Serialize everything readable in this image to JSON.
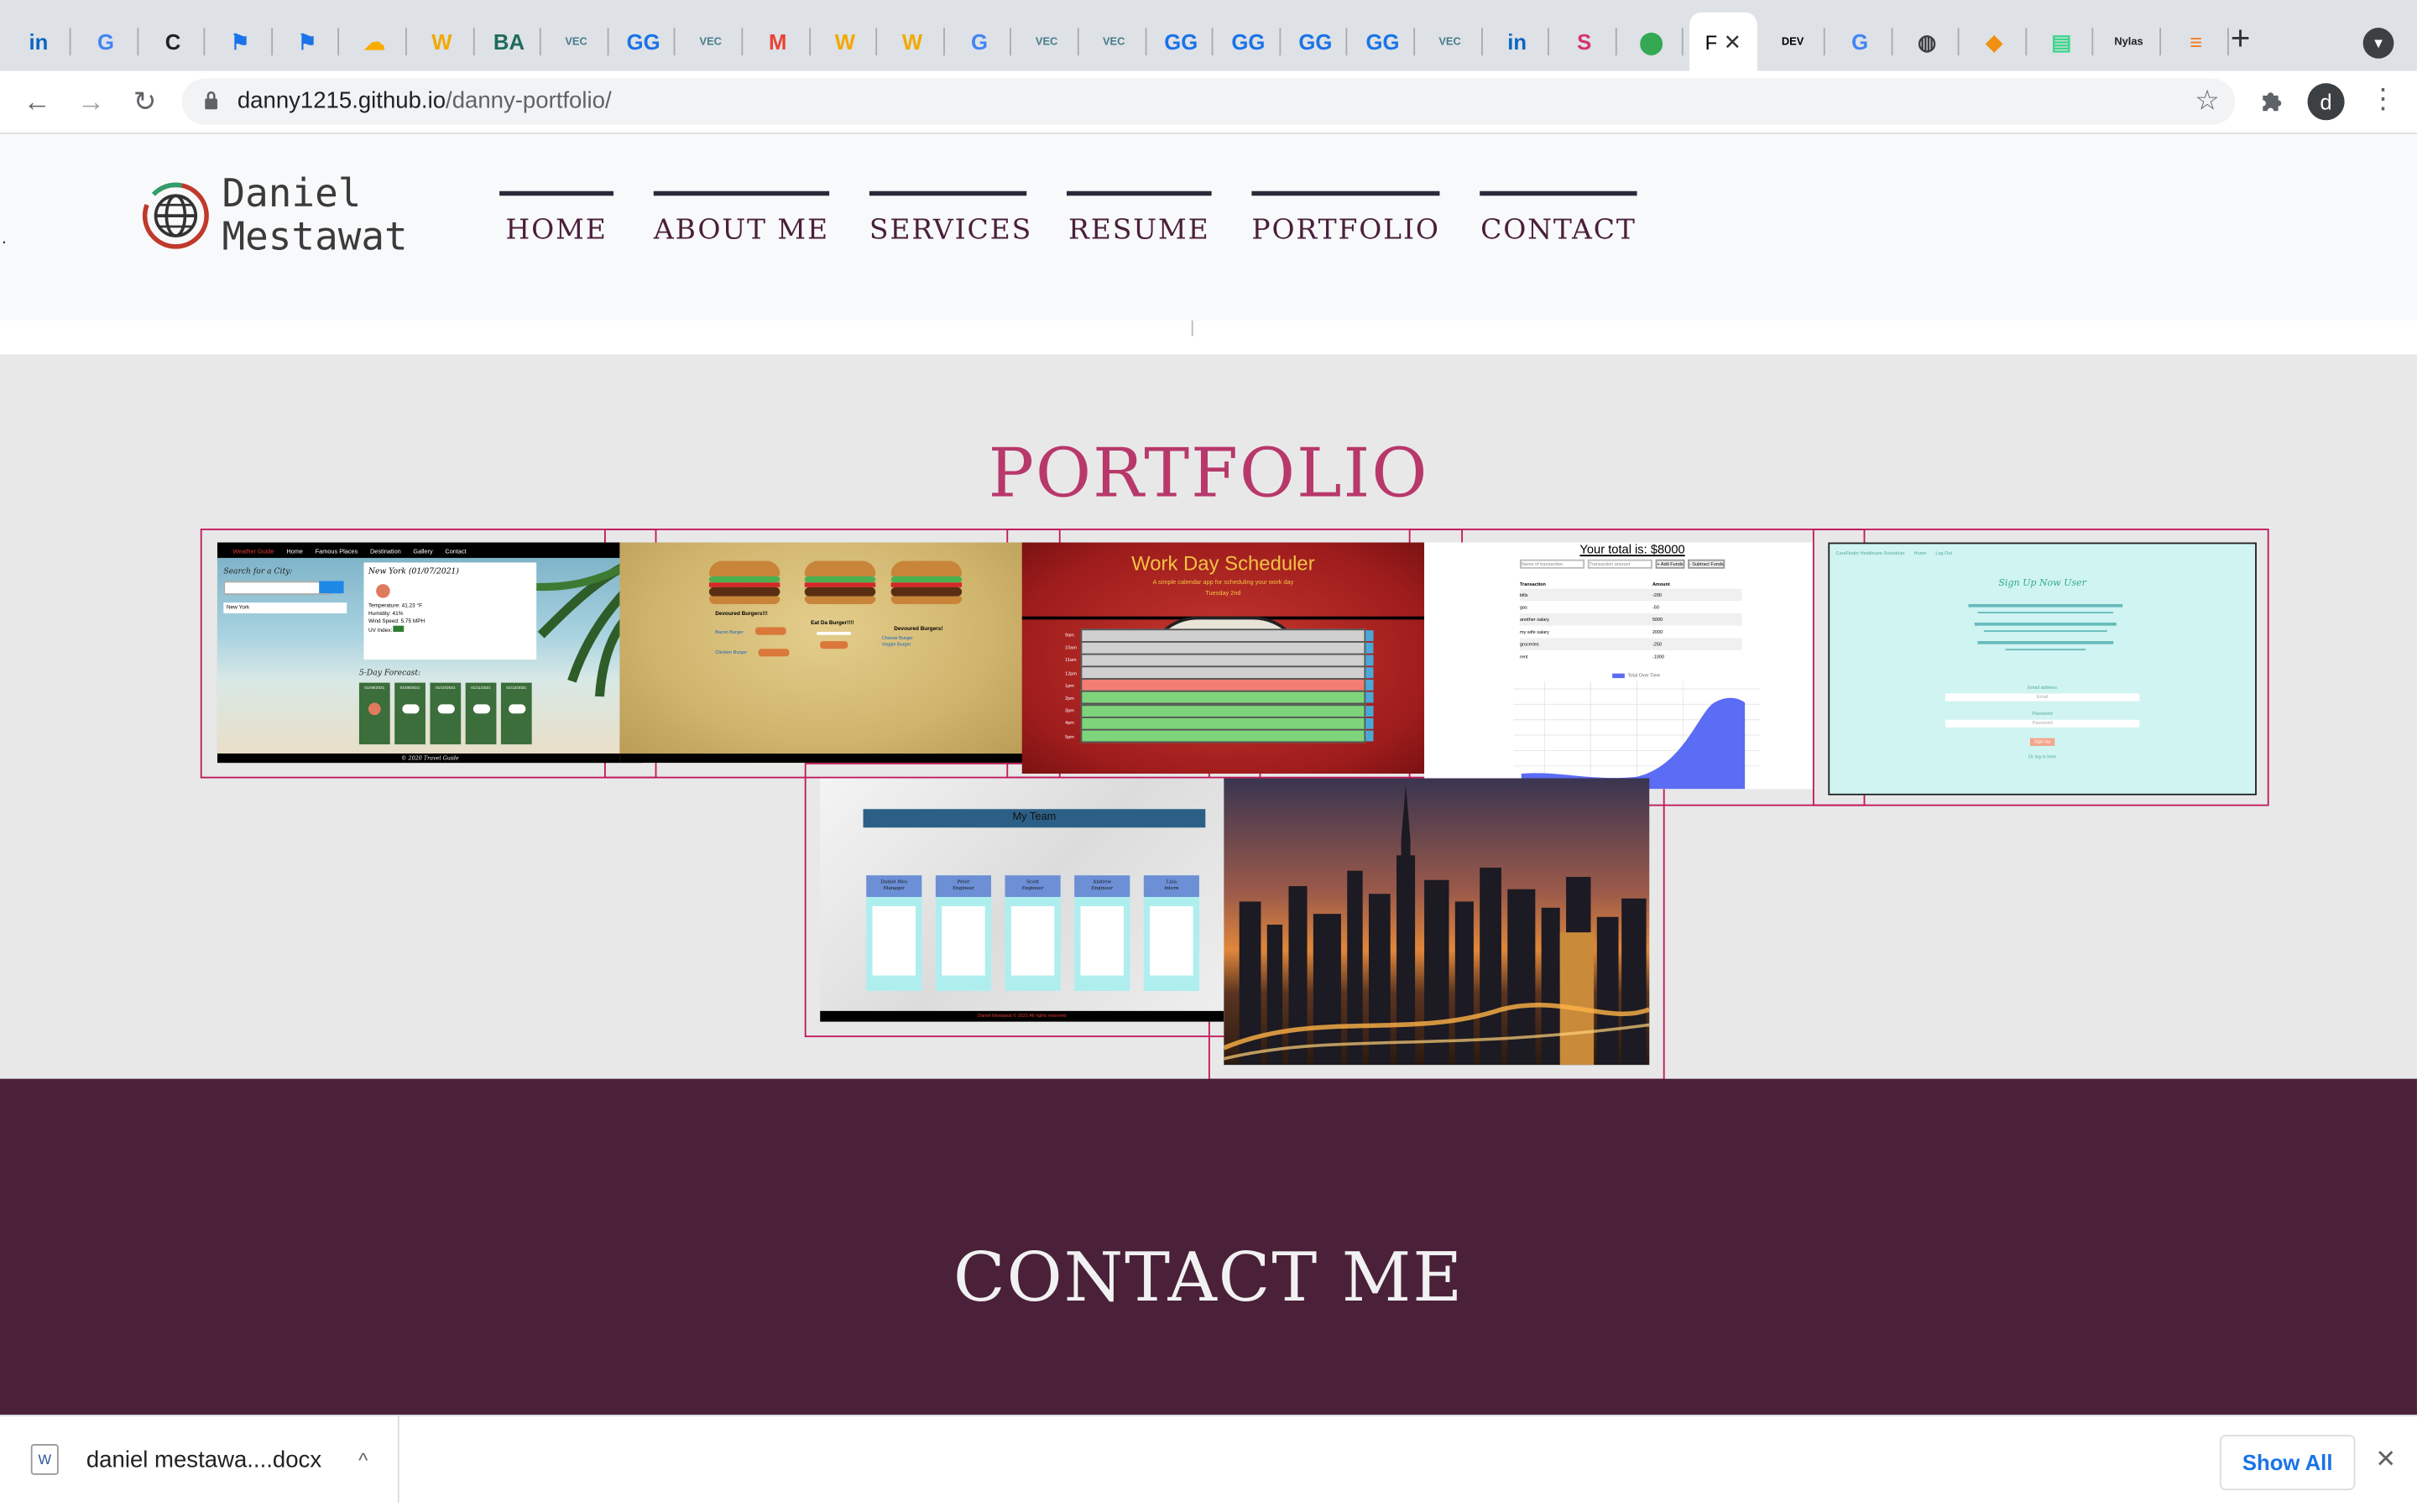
{
  "browser": {
    "tabs": [
      {
        "icon": "linkedin-icon",
        "glyph": "in",
        "color": "#0a66c2"
      },
      {
        "icon": "google-icon",
        "glyph": "G",
        "color": "#4285f4"
      },
      {
        "icon": "c-icon",
        "glyph": "C",
        "color": "#202124"
      },
      {
        "icon": "flag-icon",
        "glyph": "⚑",
        "color": "#1a73e8"
      },
      {
        "icon": "flag-icon",
        "glyph": "⚑",
        "color": "#1a73e8"
      },
      {
        "icon": "cloud-icon",
        "glyph": "☁",
        "color": "#f9ab00"
      },
      {
        "icon": "w-icon",
        "glyph": "W",
        "color": "#f2a900"
      },
      {
        "icon": "booz-allen-icon",
        "glyph": "BA",
        "color": "#1f6b5b"
      },
      {
        "icon": "vec-icon",
        "glyph": "VEC",
        "color": "#4a7c8c"
      },
      {
        "icon": "gg-icon",
        "glyph": "GG",
        "color": "#1a73e8"
      },
      {
        "icon": "vec-icon",
        "glyph": "VEC",
        "color": "#4a7c8c"
      },
      {
        "icon": "gmail-icon",
        "glyph": "M",
        "color": "#ea4335"
      },
      {
        "icon": "w-icon",
        "glyph": "W",
        "color": "#f2a900"
      },
      {
        "icon": "w-icon",
        "glyph": "W",
        "color": "#f2a900"
      },
      {
        "icon": "google-icon",
        "glyph": "G",
        "color": "#4285f4"
      },
      {
        "icon": "vec-icon",
        "glyph": "VEC",
        "color": "#4a7c8c"
      },
      {
        "icon": "vec-icon",
        "glyph": "VEC",
        "color": "#4a7c8c"
      },
      {
        "icon": "gg-icon",
        "glyph": "GG",
        "color": "#1a73e8"
      },
      {
        "icon": "gg-icon",
        "glyph": "GG",
        "color": "#1a73e8"
      },
      {
        "icon": "gg-icon",
        "glyph": "GG",
        "color": "#1a73e8"
      },
      {
        "icon": "gg-icon",
        "glyph": "GG",
        "color": "#1a73e8"
      },
      {
        "icon": "vec-icon",
        "glyph": "VEC",
        "color": "#4a7c8c"
      },
      {
        "icon": "linkedin-icon",
        "glyph": "in",
        "color": "#0a66c2"
      },
      {
        "icon": "pink-logo-icon",
        "glyph": "S",
        "color": "#d6336c"
      },
      {
        "icon": "maps-icon",
        "glyph": "⬤",
        "color": "#34a853"
      }
    ],
    "active_tab_label": "F",
    "after_tabs": [
      {
        "icon": "dev-icon",
        "glyph": "DEV",
        "color": "#000000"
      },
      {
        "icon": "google-icon",
        "glyph": "G",
        "color": "#4285f4"
      },
      {
        "icon": "globe-icon",
        "glyph": "◍",
        "color": "#3c4043"
      },
      {
        "icon": "orange-icon",
        "glyph": "◆",
        "color": "#f29111"
      },
      {
        "icon": "green-icon",
        "glyph": "▤",
        "color": "#3dd68c"
      },
      {
        "icon": "nylas-icon",
        "glyph": "Nylas",
        "color": "#202124"
      },
      {
        "icon": "stackoverflow-icon",
        "glyph": "≡",
        "color": "#f48024"
      }
    ],
    "url_host": "danny1215.github.io",
    "url_path": "/danny-portfolio/",
    "profile_initial": "d"
  },
  "site": {
    "logo_line1": "Daniel",
    "logo_line2": "Mestawat",
    "nav": [
      "HOME",
      "ABOUT ME",
      "SERVICES",
      "RESUME",
      "PORTFOLIO",
      "CONTACT"
    ]
  },
  "portfolio": {
    "title": "PORTFOLIO",
    "weather": {
      "brand": "Weather Guide",
      "menu": [
        "Home",
        "Famous Places",
        "Destination",
        "Gallery",
        "Contact"
      ],
      "search_label": "Search for a City:",
      "city": "New York",
      "heading": "New York (01/07/2021)",
      "lines": [
        "Temperature: 41.23 °F",
        "Humidity: 41%",
        "Wind Speed: 5.75 MPH",
        "UV Index:"
      ],
      "forecast_label": "5-Day Forecast:",
      "dates": [
        "01/08/2021",
        "01/09/2021",
        "01/10/2021",
        "01/11/2021",
        "01/12/2021"
      ],
      "footer": "© 2020 Travel Guide"
    },
    "burger": {
      "labels": [
        "Devoured Burgers!!!",
        "Eat Da Burger!!!!",
        "Devoured Burgers!"
      ],
      "items_left": [
        "Bacon Burger",
        "Chicken Burger"
      ],
      "items_right": [
        "Cheese Burger",
        "Veggie Burger"
      ]
    },
    "scheduler": {
      "title": "Work Day Scheduler",
      "subtitle": "A simple calendar app for scheduling your work day",
      "date": "Tuesday 2nd",
      "hours": [
        "9am",
        "10am",
        "11am",
        "12pm",
        "1pm",
        "2pm",
        "3pm",
        "4pm",
        "5pm"
      ]
    },
    "budget": {
      "title": "Your total is: $8000",
      "placeholders": [
        "Name of transaction",
        "Transaction amount"
      ],
      "buttons": [
        "+ Add Funds",
        "- Subtract Funds"
      ],
      "headers": [
        "Transaction",
        "Amount"
      ],
      "rows": [
        [
          "bills",
          "-200"
        ],
        [
          "gas",
          "-50"
        ],
        [
          "another salary",
          "5000"
        ],
        [
          "my wife salary",
          "2000"
        ],
        [
          "groceries",
          "-250"
        ],
        [
          "rent",
          "-1000"
        ]
      ],
      "legend": "Total Over Time"
    },
    "signup": {
      "brand": "CareFinder Healthcare Scheduler",
      "menu": [
        "Home",
        "Log Out"
      ],
      "heading": "Sign Up Now User",
      "email_label": "Email address",
      "email_placeholder": "Email",
      "password_label": "Password",
      "password_placeholder": "Password",
      "button": "Sign Up",
      "login_text": "Or log in here"
    },
    "team": {
      "title": "My Team",
      "members": [
        {
          "name": "Daniel Mes",
          "role": "Manager"
        },
        {
          "name": "Peter",
          "role": "Engineer"
        },
        {
          "name": "Scott",
          "role": "Engineer"
        },
        {
          "name": "Andrew",
          "role": "Engineer"
        },
        {
          "name": "Lula",
          "role": "Intern"
        }
      ],
      "footer": "Daniel Mestawat © 2021 All rights reserved"
    }
  },
  "contact": {
    "title": "CONTACT ME"
  },
  "downloads": {
    "filename": "daniel mestawa....docx",
    "show_all": "Show All"
  }
}
